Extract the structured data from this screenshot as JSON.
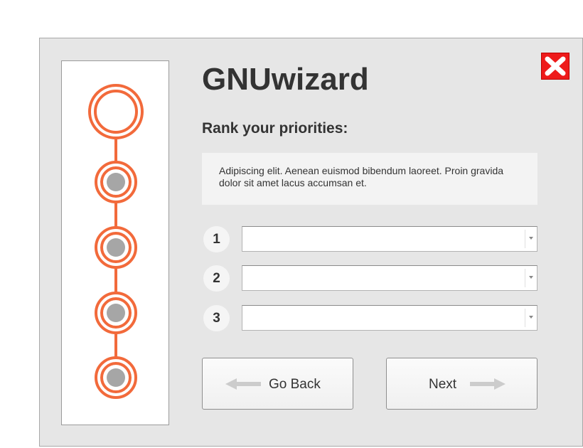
{
  "window": {
    "title": "GNUwizard",
    "close_icon": "close-icon",
    "close_color": "#ee1b1b"
  },
  "stepper": {
    "accent_color": "#f26a3b",
    "steps": [
      {
        "state": "current"
      },
      {
        "state": "pending"
      },
      {
        "state": "pending"
      },
      {
        "state": "pending"
      },
      {
        "state": "pending"
      }
    ]
  },
  "main": {
    "heading": "Rank your priorities:",
    "description": "Adipiscing elit. Aenean euismod bibendum laoreet. Proin gravida dolor sit amet lacus accumsan et.",
    "ranks": [
      {
        "number": "1",
        "value": ""
      },
      {
        "number": "2",
        "value": ""
      },
      {
        "number": "3",
        "value": ""
      }
    ]
  },
  "buttons": {
    "back_label": "Go Back",
    "back_icon": "arrow-left-icon",
    "next_label": "Next",
    "next_icon": "arrow-right-icon"
  }
}
